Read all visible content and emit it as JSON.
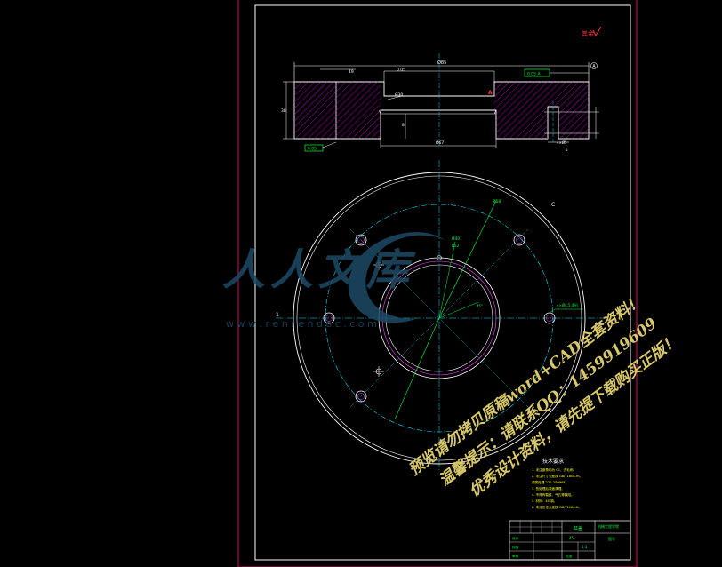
{
  "drawing": {
    "roughness_mark": "其余",
    "overall_width": "Ø85",
    "top_tolerance": "0.05",
    "top_frame_note": "0.05 A",
    "datum_label": "A",
    "left_dim": "19",
    "bore_label": "Ø30",
    "section_mark": "A",
    "lower_width": "Ø67",
    "left_height": "38",
    "inner_depth": "8",
    "hole_label": "4×Ø5",
    "small_label": "5",
    "bottom_frame_note": "0.05",
    "plan_diameter": "Ø58",
    "pcd_label": "Ø40",
    "center_label": "Ø22",
    "side_tag_left": "1",
    "side_tag_right": "C",
    "hole_callout": "4×Ø4.5 通孔",
    "angle_label": "45°"
  },
  "tech_requirements": {
    "title": "技术要求",
    "items": [
      "1. 未注倒角均为 C1，去毛刺。",
      "2. 未注尺寸公差按 GB/T1804-m。",
      "   调质处理 220-250HBS。",
      "3. 热处理后表面清理。",
      "4. 不得有裂纹、气孔等缺陷。",
      "5. 材料：45 钢。",
      "6. 未注形位公差按 GB/T1184-K。"
    ]
  },
  "title_block": {
    "part_name": "缸盖",
    "school": "机械工程学院",
    "drawing_no": "图号",
    "material": "45",
    "scale": "1:1",
    "rows": [
      "设计",
      "校核",
      "审核",
      "批准"
    ]
  },
  "watermarks": {
    "logo_text": "人人文库",
    "url": "w w w . r e n r e n d o c . c o m",
    "line1": "预览请勿拷贝原稿word+CAD全套资料！",
    "line2": "温馨提示：请联系QQ：1459919609",
    "line3": "优秀设计资料，请先提下载购买正版！"
  }
}
